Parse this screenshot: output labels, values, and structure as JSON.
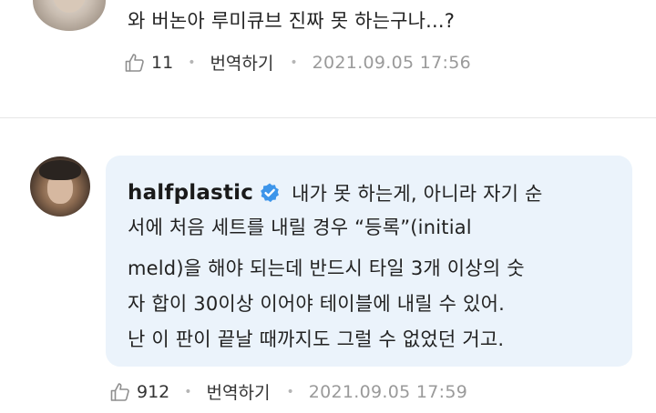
{
  "top_comment": {
    "text": "와 버논아 루미큐브 진짜 못 하는구나...?",
    "likes": "11",
    "translate_label": "번역하기",
    "timestamp": "2021.09.05 17:56"
  },
  "reply": {
    "username": "halfplastic",
    "text_line1": "내가 못 하는게, 아니라 자기 순",
    "text_line2": "서에 처음 세트를 내릴 경우 “등록”(initial",
    "text_line3": "meld)을 해야 되는데 반드시 타일 3개 이상의 숫",
    "text_line4": "자 합이 30이상 이어야 테이블에 내릴 수 있어.",
    "text_line5": "난 이 판이 끝날 때까지도 그럴 수 없었던 거고.",
    "likes": "912",
    "translate_label": "번역하기",
    "timestamp": "2021.09.05 17:59"
  },
  "colors": {
    "bubble_bg": "#ebf3fb",
    "verified_blue": "#3d95ea",
    "meta_gray": "#8e8e8e"
  },
  "icons": {
    "like": "thumbs-up-icon",
    "verified": "verified-badge-icon"
  }
}
